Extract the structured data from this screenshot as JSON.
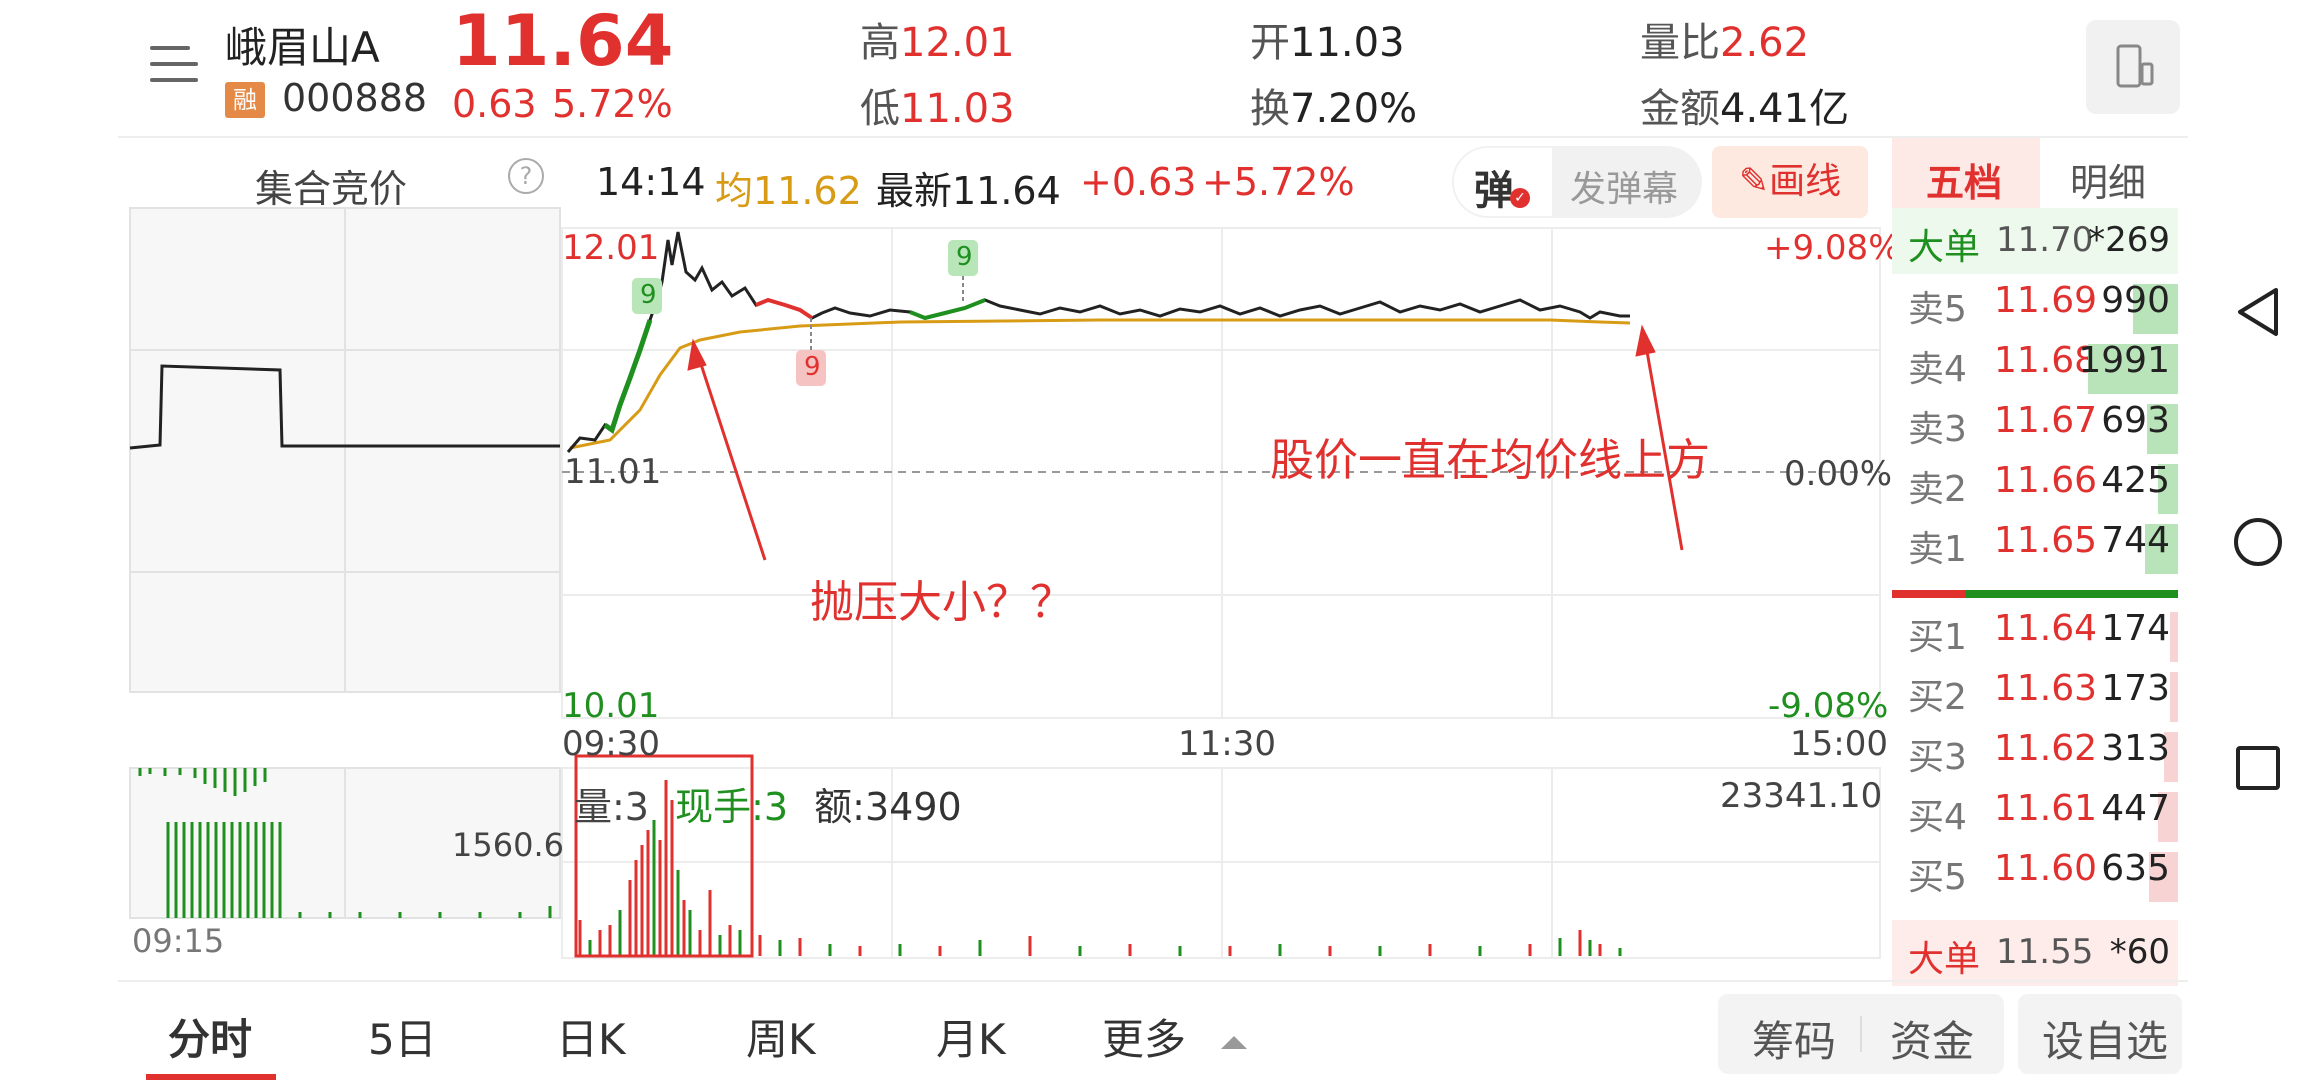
{
  "header": {
    "stock_name": "峨眉山A",
    "margin_badge": "融",
    "stock_code": "000888",
    "price": "11.64",
    "change": "0.63",
    "change_pct": "5.72%",
    "high_label": "高",
    "high_value": "12.01",
    "low_label": "低",
    "low_value": "11.03",
    "open_label": "开",
    "open_value": "11.03",
    "turnover_label": "换",
    "turnover_value": "7.20%",
    "volume_ratio_label": "量比",
    "volume_ratio_value": "2.62",
    "amount_label": "金额",
    "amount_value": "4.41亿"
  },
  "toolbar": {
    "auction_label": "集合竞价",
    "help_icon": "?",
    "time": "14:14",
    "avg_label": "均11.62",
    "latest_label": "最新11.64",
    "change": "+0.63",
    "change_pct": "+5.72%",
    "danmaku_icon": "弹",
    "danmaku_button": "发弹幕",
    "draw_button": "画线"
  },
  "chart": {
    "price_high": "12.01",
    "price_mid": "11.01",
    "price_low": "10.01",
    "pct_high": "+9.08%",
    "pct_mid": "0.00%",
    "pct_low": "-9.08%",
    "time_start": "09:30",
    "time_mid": "11:30",
    "time_end": "15:00",
    "auction_volume_label": "1560.6",
    "auction_time": "09:15",
    "vol_label": "量:3",
    "hand_label": "现手:3",
    "amt_label": "额:3490",
    "vol_max_label": "23341.10",
    "marker_9": "9",
    "annotation_1": "抛压大小？？",
    "annotation_2": "股价一直在均价线上方"
  },
  "orderbook": {
    "tab_five": "五档",
    "tab_detail": "明细",
    "big_top_label": "大单",
    "big_top_price": "11.70",
    "big_top_vol": "*269",
    "asks": [
      {
        "label": "卖5",
        "price": "11.69",
        "vol": "990",
        "frac": 0.5
      },
      {
        "label": "卖4",
        "price": "11.68",
        "vol": "1991",
        "frac": 1.0
      },
      {
        "label": "卖3",
        "price": "11.67",
        "vol": "693",
        "frac": 0.35
      },
      {
        "label": "卖2",
        "price": "11.66",
        "vol": "425",
        "frac": 0.22
      },
      {
        "label": "卖1",
        "price": "11.65",
        "vol": "744",
        "frac": 0.37
      }
    ],
    "bids": [
      {
        "label": "买1",
        "price": "11.64",
        "vol": "174",
        "frac": 0.09
      },
      {
        "label": "买2",
        "price": "11.63",
        "vol": "173",
        "frac": 0.09
      },
      {
        "label": "买3",
        "price": "11.62",
        "vol": "313",
        "frac": 0.16
      },
      {
        "label": "买4",
        "price": "11.61",
        "vol": "447",
        "frac": 0.22
      },
      {
        "label": "买5",
        "price": "11.60",
        "vol": "635",
        "frac": 0.32
      }
    ],
    "big_bottom_label": "大单",
    "big_bottom_price": "11.55",
    "big_bottom_vol": "*60"
  },
  "tabs": {
    "intraday": "分时",
    "five_day": "5日",
    "day_k": "日K",
    "week_k": "周K",
    "month_k": "月K",
    "more": "更多",
    "chips": "筹码",
    "funds": "资金",
    "watchlist": "设自选"
  },
  "colors": {
    "up": "#e0312f",
    "down": "#1f8f1f",
    "avg": "#d89b16",
    "bg": "#ffffff"
  }
}
